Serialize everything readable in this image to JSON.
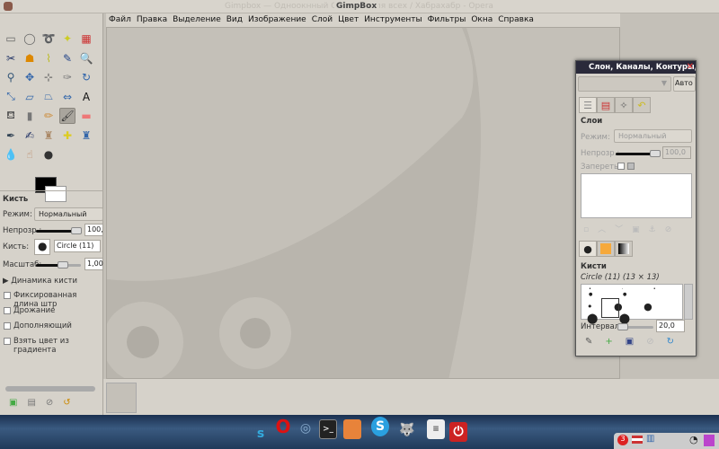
{
  "window": {
    "title": "Gimpbox — Одноокнный GimpBox для всех / Хабрахабр - Opera",
    "app_title": "GimpBox"
  },
  "menu": [
    "Файл",
    "Правка",
    "Выделение",
    "Вид",
    "Изображение",
    "Слой",
    "Цвет",
    "Инструменты",
    "Фильтры",
    "Окна",
    "Справка"
  ],
  "tools": [
    {
      "icon": "rect-select-icon",
      "g": "▭",
      "c": "#666"
    },
    {
      "icon": "ellipse-select-icon",
      "g": "◯",
      "c": "#666"
    },
    {
      "icon": "free-select-icon",
      "g": "➰",
      "c": "#888"
    },
    {
      "icon": "fuzzy-select-icon",
      "g": "✦",
      "c": "#cc2"
    },
    {
      "icon": "color-select-icon",
      "g": "▦",
      "c": "#c33"
    },
    {
      "icon": "scissors-icon",
      "g": "✂",
      "c": "#236"
    },
    {
      "icon": "foreground-select-icon",
      "g": "☗",
      "c": "#d80"
    },
    {
      "icon": "paths-icon",
      "g": "⌇",
      "c": "#bb2"
    },
    {
      "icon": "color-picker-icon",
      "g": "✎",
      "c": "#248"
    },
    {
      "icon": "zoom-icon",
      "g": "🔍",
      "c": "#57a"
    },
    {
      "icon": "measure-icon",
      "g": "⚲",
      "c": "#357"
    },
    {
      "icon": "move-icon",
      "g": "✥",
      "c": "#36a"
    },
    {
      "icon": "align-icon",
      "g": "⊹",
      "c": "#555"
    },
    {
      "icon": "crop-icon",
      "g": "✑",
      "c": "#777"
    },
    {
      "icon": "rotate-icon",
      "g": "↻",
      "c": "#36a"
    },
    {
      "icon": "scale-icon",
      "g": "⤡",
      "c": "#36a"
    },
    {
      "icon": "shear-icon",
      "g": "▱",
      "c": "#36a"
    },
    {
      "icon": "perspective-icon",
      "g": "⏢",
      "c": "#36a"
    },
    {
      "icon": "flip-icon",
      "g": "⇔",
      "c": "#36a"
    },
    {
      "icon": "text-icon",
      "g": "A",
      "c": "#111"
    },
    {
      "icon": "bucket-fill-icon",
      "g": "⛾",
      "c": "#555"
    },
    {
      "icon": "blend-icon",
      "g": "▮",
      "c": "#777"
    },
    {
      "icon": "pencil-icon",
      "g": "✏",
      "c": "#c83"
    },
    {
      "icon": "paintbrush-icon",
      "g": "🖌",
      "c": "#333",
      "active": true
    },
    {
      "icon": "eraser-icon",
      "g": "▬",
      "c": "#e77"
    },
    {
      "icon": "airbrush-icon",
      "g": "✒",
      "c": "#345"
    },
    {
      "icon": "ink-icon",
      "g": "✍",
      "c": "#236"
    },
    {
      "icon": "clone-icon",
      "g": "♜",
      "c": "#a86"
    },
    {
      "icon": "heal-icon",
      "g": "✚",
      "c": "#dc2"
    },
    {
      "icon": "perspective-clone-icon",
      "g": "♜",
      "c": "#36a"
    },
    {
      "icon": "blur-icon",
      "g": "💧",
      "c": "#58b"
    },
    {
      "icon": "smudge-icon",
      "g": "☝",
      "c": "#b86"
    },
    {
      "icon": "dodge-burn-icon",
      "g": "●",
      "c": "#333"
    }
  ],
  "tool_options": {
    "title": "Кисть",
    "mode_label": "Режим:",
    "mode_value": "Нормальный",
    "opacity_label": "Непрозр.:",
    "opacity_value": "100,",
    "brush_label": "Кисть:",
    "brush_value": "Circle (11)",
    "scale_label": "Масштаб:",
    "scale_value": "1,00",
    "dynamics_label": "Динамика кисти",
    "checkboxes": [
      "Фиксированная длина штр",
      "Дрожание",
      "Дополняющий",
      "Взять цвет из градиента"
    ]
  },
  "dock": {
    "title": "Слон, Каналы, Контуры, С",
    "auto_button": "Авто",
    "layers": {
      "title": "Слои",
      "mode_label": "Режим:",
      "mode_value": "Нормальный",
      "opacity_label": "Непрозр.:",
      "opacity_value": "100,0",
      "lock_label": "Запереть:"
    },
    "brushes": {
      "title": "Кисти",
      "selected": "Circle (11) (13 × 13)",
      "spacing_label": "Интервал:",
      "spacing_value": "20,0"
    }
  },
  "colors": {
    "accent": "#2a2a3a",
    "background": "#c4c0b8"
  }
}
